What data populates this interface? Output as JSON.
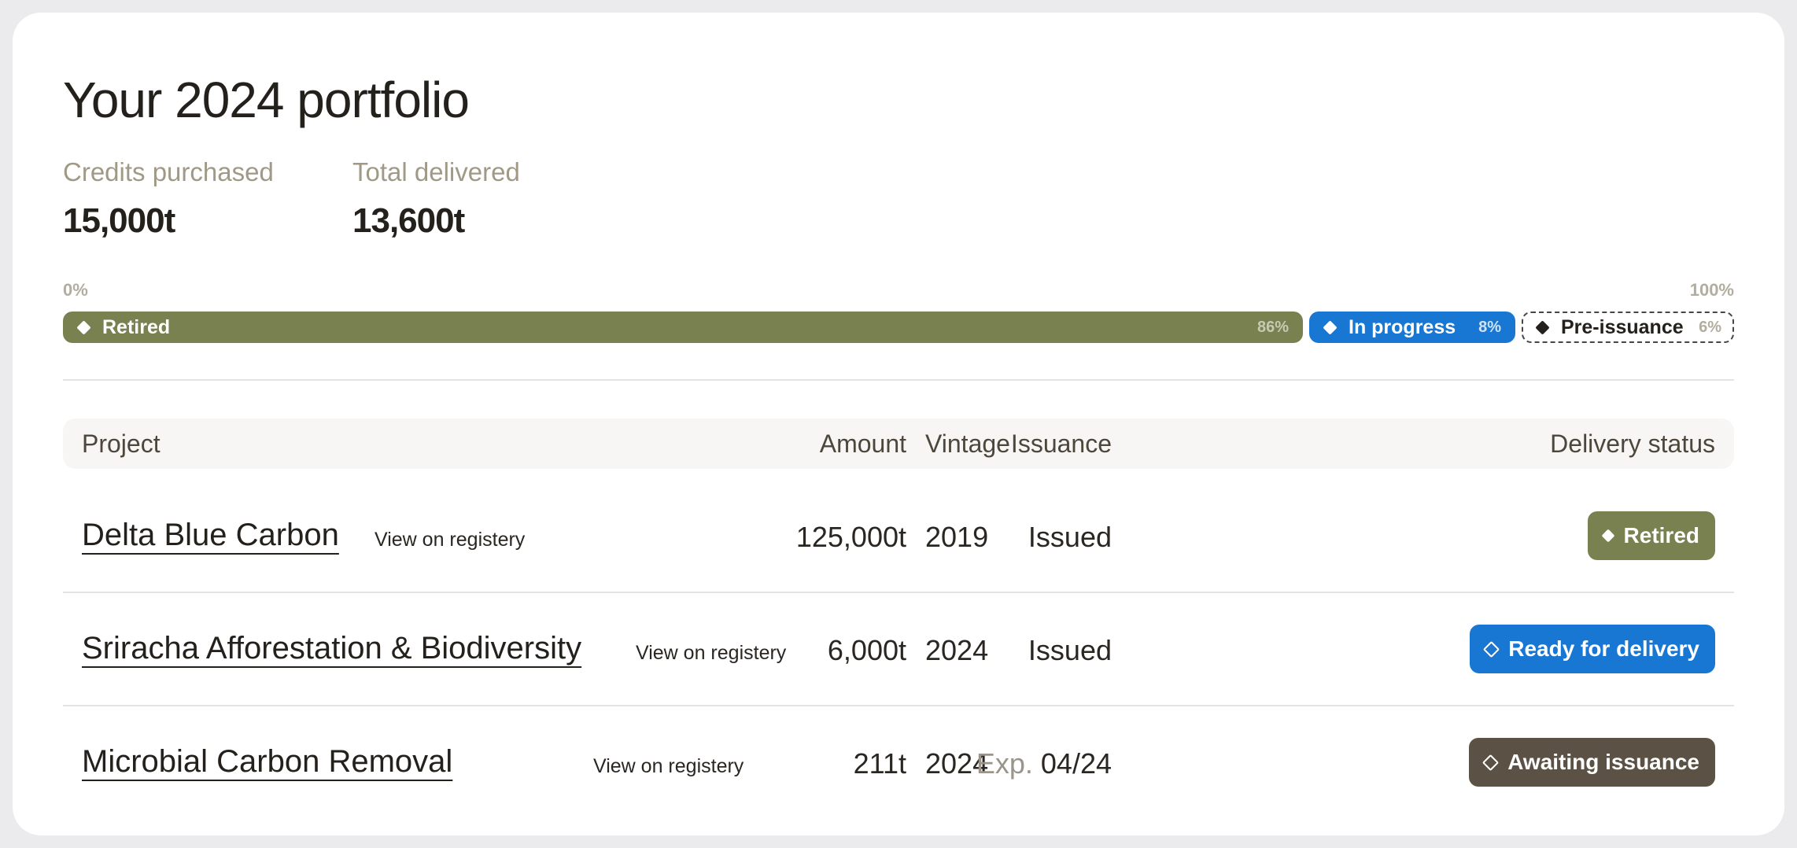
{
  "title": "Your 2024 portfolio",
  "stats": {
    "credits_purchased": {
      "label": "Credits purchased",
      "value": "15,000t"
    },
    "total_delivered": {
      "label": "Total delivered",
      "value": "13,600t"
    }
  },
  "progress": {
    "start_label": "0%",
    "end_label": "100%",
    "segments": [
      {
        "label": "Retired",
        "percent_label": "86%",
        "fraction": 0.86,
        "color": "#7a8150"
      },
      {
        "label": "In progress",
        "percent_label": "8%",
        "fraction": 0.08,
        "color": "#1877d2"
      },
      {
        "label": "Pre-issuance",
        "percent_label": "6%",
        "fraction": 0.06,
        "color": "#ffffff"
      }
    ]
  },
  "table": {
    "headers": {
      "project": "Project",
      "vintage": "Vintage",
      "amount": "Amount",
      "issuance": "Issuance",
      "status": "Delivery status"
    },
    "rows": [
      {
        "project": "Delta Blue Carbon",
        "registry": "View on registery",
        "vintage": "2019",
        "amount": "125,000t",
        "issuance": "Issued",
        "status": "Retired",
        "status_color": "#7a8150"
      },
      {
        "project": "Sriracha Afforestation & Biodiversity",
        "registry": "View on registery",
        "vintage": "2024",
        "amount": "6,000t",
        "issuance": "Issued",
        "status": "Ready for delivery",
        "status_color": "#1877d2"
      },
      {
        "project": "Microbial Carbon Removal",
        "registry": "View on registery",
        "vintage": "2024",
        "amount": "211t",
        "issuance_prefix": "Exp.",
        "issuance": "04/24",
        "status": "Awaiting issuance",
        "status_color": "#5b5245"
      }
    ]
  },
  "icons": {
    "retired": "diamond-filled-icon",
    "in_progress": "diamond-filled-icon",
    "pre_issuance": "diamond-filled-icon",
    "ready": "diamond-outline-icon",
    "awaiting": "diamond-outline-icon"
  }
}
